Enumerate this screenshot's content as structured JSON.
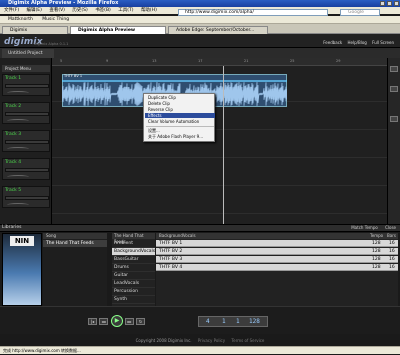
{
  "browser": {
    "title": "Digimix Alpha Preview - Mozilla Firefox",
    "menu": [
      "文件(F)",
      "编辑(E)",
      "查看(V)",
      "历史(S)",
      "书签(B)",
      "工具(T)",
      "帮助(H)"
    ],
    "url": "http://www.digimix.com/alpha/",
    "search_placeholder": "Google",
    "bookmarks": [
      "Mattknorth",
      "Music Thing"
    ],
    "tabs": [
      "Digimix",
      "Digimix Alpha Preview",
      "Adobe Edge: September/October..."
    ],
    "status": "完成 http://www.digimix.com 转换数据..."
  },
  "app": {
    "logo": "digimix",
    "version": "Digimix Alpha 0.1.1",
    "header_links": [
      "Feedback",
      "Help/Blog",
      "Full Screen"
    ],
    "project_tab": "Untitled Project",
    "project_menu": "Project Menu"
  },
  "tracks": [
    {
      "label": "Track 1"
    },
    {
      "label": "Track 2"
    },
    {
      "label": "Track 3"
    },
    {
      "label": "Track 4"
    },
    {
      "label": "Track 5"
    }
  ],
  "ruler": [
    "5",
    "9",
    "13",
    "17",
    "21",
    "25",
    "29"
  ],
  "clip": {
    "label": "THTF BV 1"
  },
  "context_menu": {
    "items": [
      "Duplicate Clip",
      "Delete Clip",
      "Reverse Clip",
      "Effects",
      "Clear Volume Automation",
      "设置...",
      "关于 Adobe Flash Player 9..."
    ],
    "highlighted": "Effects"
  },
  "library": {
    "title": "Libraries",
    "right_label": "Match Tempo",
    "close": "Close",
    "song_header": "Song",
    "song": "The Hand That Feeds",
    "cat_header": "The Hand That Feeds",
    "categories": [
      "Ambient",
      "BackgroundVocals",
      "BassGuitar",
      "Drums",
      "Guitar",
      "LeadVocals",
      "Percussion",
      "Synth"
    ],
    "selected_category": "BackgroundVocals",
    "clip_header": "BackgroundVocals",
    "tempo_header": "Tempo",
    "bars_header": "Bars",
    "clips": [
      {
        "name": "THTF BV 1",
        "tempo": "128",
        "bars": "16"
      },
      {
        "name": "THTF BV 2",
        "tempo": "128",
        "bars": "16"
      },
      {
        "name": "THTF BV 3",
        "tempo": "128",
        "bars": "16"
      },
      {
        "name": "THTF BV 4",
        "tempo": "128",
        "bars": "16"
      }
    ]
  },
  "transport": {
    "bar": "4",
    "beat": "1",
    "tick": "1",
    "tempo": "128"
  },
  "footer": {
    "copyright": "Copyright 2008 Digimix Inc.",
    "privacy": "Privacy Policy",
    "terms": "Terms of Service"
  },
  "colors": {
    "track_label": "#4cd94c",
    "clip_fill": "#2f4e70",
    "menu_highlight": "#2c4c9c"
  }
}
